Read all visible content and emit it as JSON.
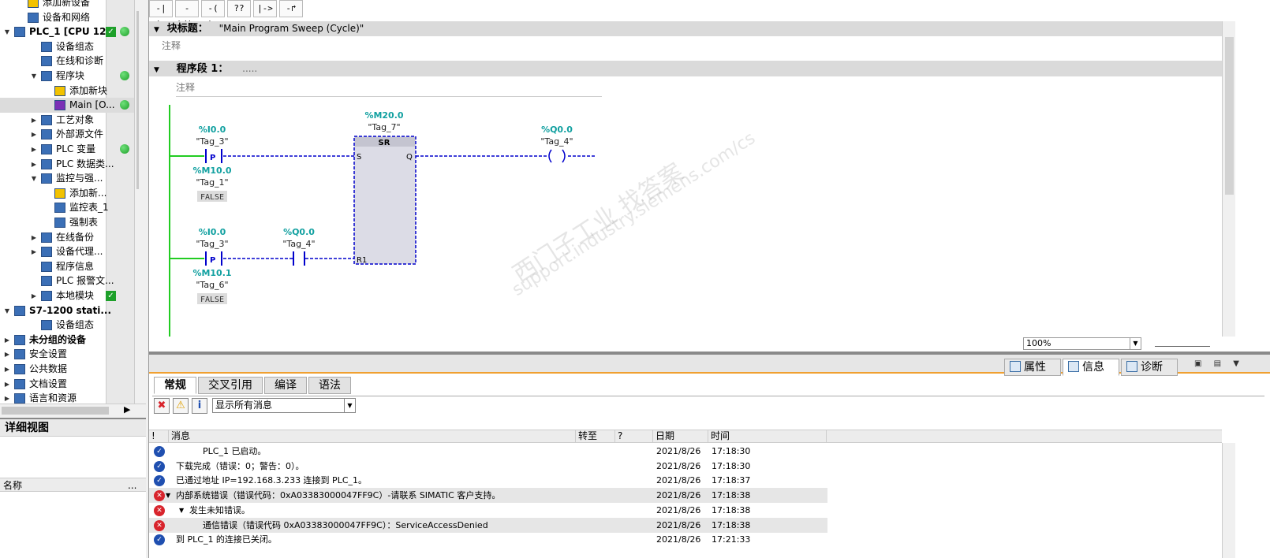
{
  "tree": {
    "items": [
      {
        "label": "添加新设备",
        "indent": 2,
        "arrow": "",
        "icon": "add-device-icon",
        "status": ""
      },
      {
        "label": "设备和网络",
        "indent": 2,
        "arrow": "",
        "icon": "network-icon",
        "status": ""
      },
      {
        "label": "PLC_1 [CPU 12...",
        "indent": 1,
        "arrow": "down",
        "icon": "plc-icon",
        "status": "check-dot",
        "group": true
      },
      {
        "label": "设备组态",
        "indent": 3,
        "arrow": "",
        "icon": "device-config-icon",
        "status": ""
      },
      {
        "label": "在线和诊断",
        "indent": 3,
        "arrow": "",
        "icon": "online-diagnostics-icon",
        "status": ""
      },
      {
        "label": "程序块",
        "indent": 3,
        "arrow": "down",
        "icon": "folder-icon",
        "status": "dot"
      },
      {
        "label": "添加新块",
        "indent": 4,
        "arrow": "",
        "icon": "add-block-icon",
        "status": ""
      },
      {
        "label": "Main [O...",
        "indent": 4,
        "arrow": "",
        "icon": "ob-block-icon",
        "status": "dot",
        "selected": true
      },
      {
        "label": "工艺对象",
        "indent": 3,
        "arrow": "right",
        "icon": "folder-icon",
        "status": ""
      },
      {
        "label": "外部源文件",
        "indent": 3,
        "arrow": "right",
        "icon": "folder-icon",
        "status": ""
      },
      {
        "label": "PLC 变量",
        "indent": 3,
        "arrow": "right",
        "icon": "folder-icon",
        "status": "dot"
      },
      {
        "label": "PLC 数据类...",
        "indent": 3,
        "arrow": "right",
        "icon": "folder-icon",
        "status": ""
      },
      {
        "label": "监控与强...",
        "indent": 3,
        "arrow": "down",
        "icon": "folder-icon",
        "status": ""
      },
      {
        "label": "添加新...",
        "indent": 4,
        "arrow": "",
        "icon": "add-table-icon",
        "status": ""
      },
      {
        "label": "监控表_1",
        "indent": 4,
        "arrow": "",
        "icon": "watch-table-icon",
        "status": ""
      },
      {
        "label": "强制表",
        "indent": 4,
        "arrow": "",
        "icon": "force-table-icon",
        "status": ""
      },
      {
        "label": "在线备份",
        "indent": 3,
        "arrow": "right",
        "icon": "folder-icon",
        "status": ""
      },
      {
        "label": "设备代理...",
        "indent": 3,
        "arrow": "right",
        "icon": "folder-icon",
        "status": ""
      },
      {
        "label": "程序信息",
        "indent": 3,
        "arrow": "",
        "icon": "program-info-icon",
        "status": ""
      },
      {
        "label": "PLC 报警文...",
        "indent": 3,
        "arrow": "",
        "icon": "alarm-text-icon",
        "status": ""
      },
      {
        "label": "本地模块",
        "indent": 3,
        "arrow": "right",
        "icon": "folder-icon",
        "status": "check"
      },
      {
        "label": "S7-1200 stati...",
        "indent": 1,
        "arrow": "down",
        "icon": "station-icon",
        "status": "",
        "group": true
      },
      {
        "label": "设备组态",
        "indent": 3,
        "arrow": "",
        "icon": "device-config-icon",
        "status": ""
      },
      {
        "label": "未分组的设备",
        "indent": 1,
        "arrow": "right",
        "icon": "ungrouped-icon",
        "status": "",
        "group": true
      },
      {
        "label": "安全设置",
        "indent": 1,
        "arrow": "right",
        "icon": "security-icon",
        "status": ""
      },
      {
        "label": "公共数据",
        "indent": 1,
        "arrow": "right",
        "icon": "common-data-icon",
        "status": ""
      },
      {
        "label": "文档设置",
        "indent": 1,
        "arrow": "right",
        "icon": "doc-settings-icon",
        "status": ""
      },
      {
        "label": "语言和资源",
        "indent": 1,
        "arrow": "right",
        "icon": "language-icon",
        "status": ""
      }
    ]
  },
  "detail": {
    "title": "详细视图",
    "col_name": "名称",
    "col_more": "..."
  },
  "editor": {
    "toolbar": [
      "-| |-",
      "-|/|-",
      "-( )-",
      "??",
      "|->",
      "-↱"
    ],
    "block_title_label": "块标题：",
    "block_title_value": "\"Main Program Sweep (Cycle)\"",
    "comment": "注释",
    "network_label": "程序段 1：",
    "network_dots": ".....",
    "network_comment": "注释",
    "zoom": "100%"
  },
  "ladder": {
    "rung1": {
      "contact": {
        "addr": "%I0.0",
        "tag": "\"Tag_3\"",
        "label": "P"
      },
      "edge_mem": {
        "addr": "%M10.0",
        "tag": "\"Tag_1\"",
        "value": "FALSE"
      },
      "sr": {
        "addr": "%M20.0",
        "tag": "\"Tag_7\"",
        "title": "SR",
        "in_s": "S",
        "in_r": "R1",
        "out_q": "Q"
      },
      "coil": {
        "addr": "%Q0.0",
        "tag": "\"Tag_4\""
      }
    },
    "rung2": {
      "contact": {
        "addr": "%I0.0",
        "tag": "\"Tag_3\"",
        "label": "P"
      },
      "edge_mem": {
        "addr": "%M10.1",
        "tag": "\"Tag_6\"",
        "value": "FALSE"
      },
      "no_contact": {
        "addr": "%Q0.0",
        "tag": "\"Tag_4\""
      }
    },
    "watermark1": "西门子工业  找答案",
    "watermark2": "support.industry.siemens.com/cs",
    "colors": {
      "wire": "#0000cc",
      "power_rail": "#22cc22",
      "address": "#11a0a0",
      "box_fill": "#dcdce6"
    }
  },
  "inspector": {
    "tabs": [
      {
        "label": "属性",
        "icon": "properties-icon"
      },
      {
        "label": "信息",
        "icon": "info-icon",
        "active": true
      },
      {
        "label": "诊断",
        "icon": "diagnostics-icon"
      }
    ],
    "subtabs": [
      {
        "label": "常规",
        "active": true
      },
      {
        "label": "交叉引用"
      },
      {
        "label": "编译"
      },
      {
        "label": "语法"
      }
    ],
    "filter": {
      "selected": "显示所有消息"
    },
    "columns": {
      "flag": "!",
      "message": "消息",
      "goto": "转至",
      "q": "?",
      "date": "日期",
      "time": "时间"
    },
    "messages": [
      {
        "status": "ok",
        "indent": 3,
        "tri": "",
        "text": "PLC_1 已启动。",
        "date": "2021/8/26",
        "time": "17:18:30"
      },
      {
        "status": "ok",
        "indent": 1,
        "tri": "",
        "text": "下载完成（错误：0；警告：0）。",
        "date": "2021/8/26",
        "time": "17:18:30"
      },
      {
        "status": "ok",
        "indent": 1,
        "tri": "",
        "text": "已通过地址 IP=192.168.3.233 连接到 PLC_1。",
        "date": "2021/8/26",
        "time": "17:18:37"
      },
      {
        "status": "err",
        "indent": 1,
        "tri": "down",
        "text": "内部系统错误（错误代码：0xA03383000047FF9C）-请联系 SIMATIC 客户支持。",
        "date": "2021/8/26",
        "time": "17:18:38",
        "hl": true
      },
      {
        "status": "err",
        "indent": 2,
        "tri": "down",
        "text": "发生未知错误。",
        "date": "2021/8/26",
        "time": "17:18:38"
      },
      {
        "status": "err",
        "indent": 3,
        "tri": "",
        "text": "通信错误（错误代码 0xA03383000047FF9C）：ServiceAccessDenied",
        "date": "2021/8/26",
        "time": "17:18:38",
        "hl": true
      },
      {
        "status": "ok",
        "indent": 1,
        "tri": "",
        "text": "到 PLC_1 的连接已关闭。",
        "date": "2021/8/26",
        "time": "17:21:33"
      }
    ]
  }
}
